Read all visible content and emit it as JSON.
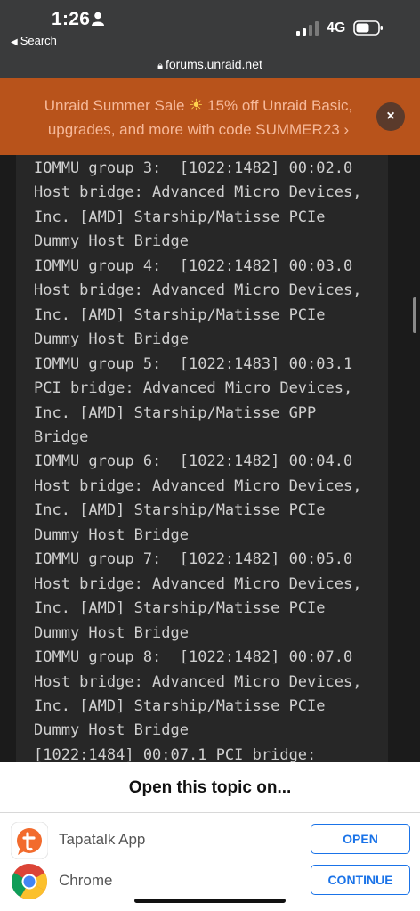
{
  "status_bar": {
    "time": "1:26",
    "back_label": "Search",
    "network": "4G"
  },
  "browser": {
    "url": "forums.unraid.net"
  },
  "promo": {
    "text_before": "Unraid Summer Sale",
    "text_after": "15% off Unraid Basic, upgrades, and more with code SUMMER23",
    "arrow": "›",
    "close_glyph": "×",
    "color": "#b8531b"
  },
  "code_lines": [
    "IOMMU group 3:  [1022:1482] 00:02.0",
    "Host bridge: Advanced Micro Devices,",
    "Inc. [AMD] Starship/Matisse PCIe",
    "Dummy Host Bridge",
    "IOMMU group 4:  [1022:1482] 00:03.0",
    "Host bridge: Advanced Micro Devices,",
    "Inc. [AMD] Starship/Matisse PCIe",
    "Dummy Host Bridge",
    "IOMMU group 5:  [1022:1483] 00:03.1",
    "PCI bridge: Advanced Micro Devices,",
    "Inc. [AMD] Starship/Matisse GPP",
    "Bridge",
    "IOMMU group 6:  [1022:1482] 00:04.0",
    "Host bridge: Advanced Micro Devices,",
    "Inc. [AMD] Starship/Matisse PCIe",
    "Dummy Host Bridge",
    "IOMMU group 7:  [1022:1482] 00:05.0",
    "Host bridge: Advanced Micro Devices,",
    "Inc. [AMD] Starship/Matisse PCIe",
    "Dummy Host Bridge",
    "IOMMU group 8:  [1022:1482] 00:07.0",
    "Host bridge: Advanced Micro Devices,",
    "Inc. [AMD] Starship/Matisse PCIe",
    "Dummy Host Bridge",
    "[1022:1484] 00:07.1 PCI bridge:"
  ],
  "sheet": {
    "title": "Open this topic on...",
    "apps": [
      {
        "name": "Tapatalk App",
        "button": "OPEN",
        "icon": "tapatalk-icon"
      },
      {
        "name": "Chrome",
        "button": "CONTINUE",
        "icon": "chrome-icon"
      }
    ],
    "button_color": "#1a73e8"
  }
}
